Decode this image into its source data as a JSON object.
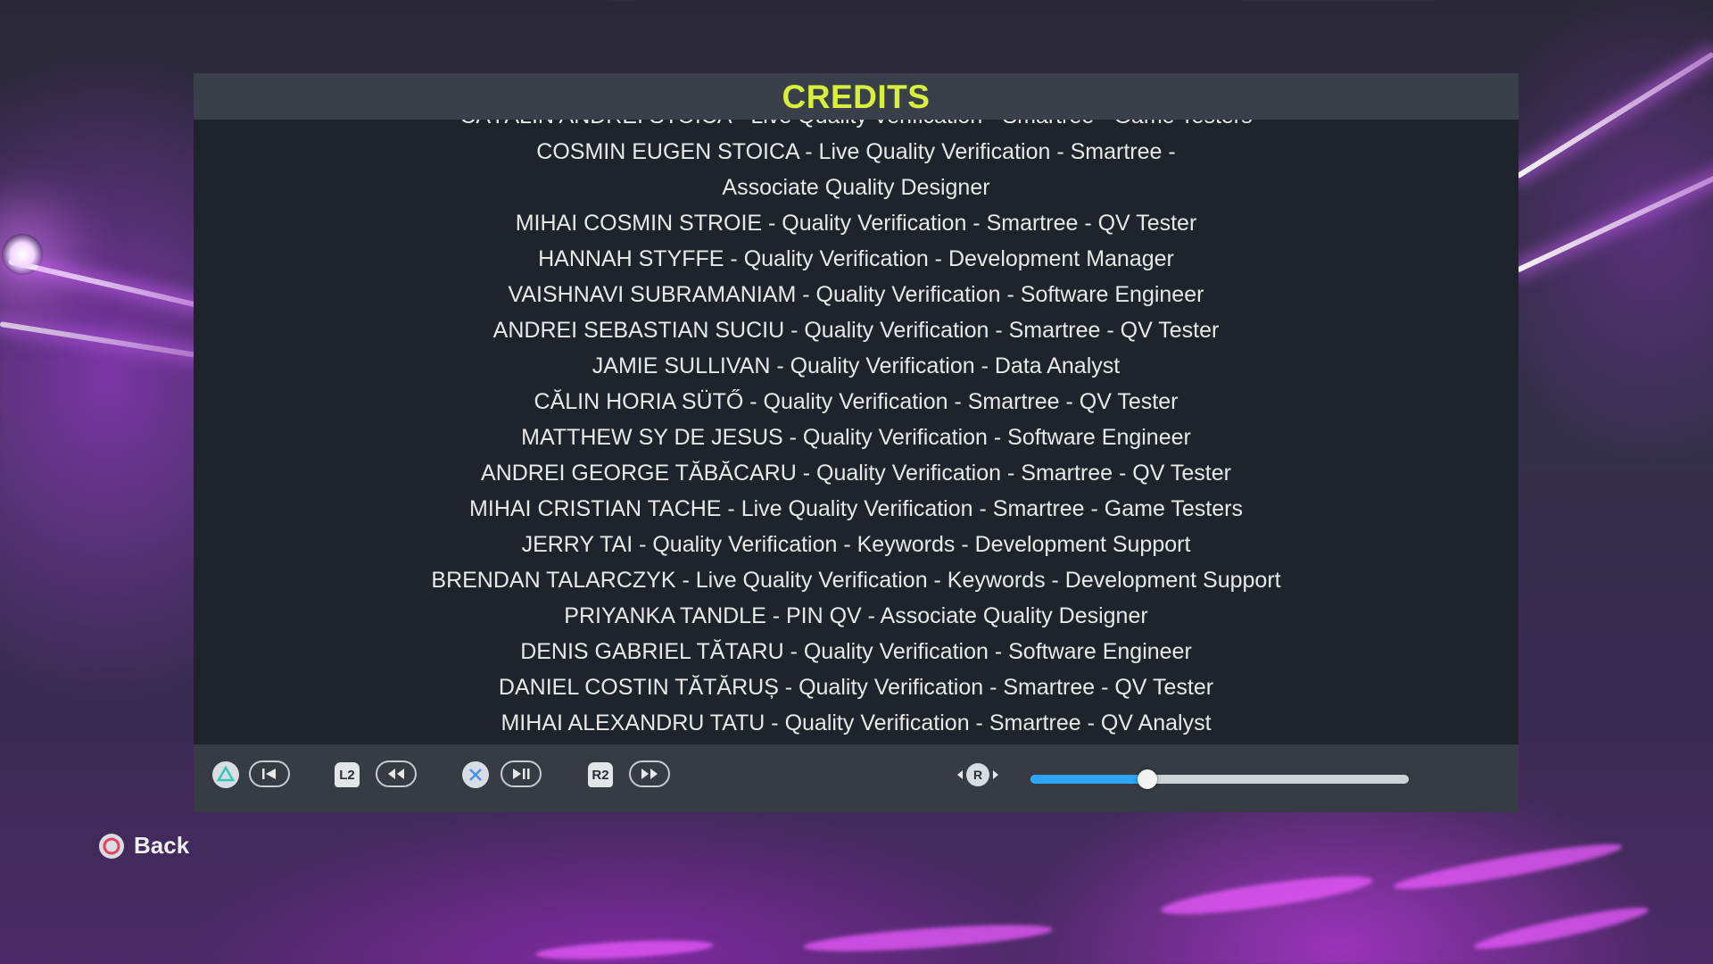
{
  "title": "CREDITS",
  "credits": [
    "CĂTĂLIN ANDREI STOICA - Live Quality Verification - Smartree - Game Testers",
    "COSMIN EUGEN STOICA - Live Quality Verification - Smartree - Associate Quality Designer",
    "MIHAI COSMIN STROIE - Quality Verification - Smartree - QV Tester",
    "HANNAH STYFFE - Quality Verification - Development Manager",
    "VAISHNAVI SUBRAMANIAM - Quality Verification - Software Engineer",
    "ANDREI SEBASTIAN SUCIU - Quality Verification - Smartree - QV Tester",
    "JAMIE SULLIVAN - Quality Verification - Data Analyst",
    "CĂLIN HORIA SÜTŐ - Quality Verification - Smartree - QV Tester",
    "MATTHEW SY DE JESUS - Quality Verification - Software Engineer",
    "ANDREI GEORGE TĂBĂCARU - Quality Verification - Smartree - QV Tester",
    "MIHAI CRISTIAN TACHE - Live Quality Verification - Smartree - Game Testers",
    "JERRY TAI - Quality Verification - Keywords - Development Support",
    "BRENDAN TALARCZYK - Live Quality Verification - Keywords - Development Support",
    "PRIYANKA TANDLE - PIN QV - Associate Quality Designer",
    "DENIS GABRIEL TĂTARU - Quality Verification - Software Engineer",
    "DANIEL COSTIN TĂTĂRUȘ - Quality Verification - Smartree - QV Tester",
    "MIHAI ALEXANDRU TATU - Quality Verification - Smartree - QV Analyst"
  ],
  "controls": {
    "l2_label": "L2",
    "r2_label": "R2",
    "r_stick_label": "R",
    "progress": 0.31
  },
  "back": {
    "label": "Back"
  },
  "colors": {
    "title": "#d8f03c",
    "progress_fill": "#2ea6ff",
    "triangle": "#33c8b4",
    "cross": "#4b8fe8",
    "circle": "#e8425a"
  },
  "icons": [
    "triangle-button-icon",
    "skip-to-start-icon",
    "rewind-icon",
    "cross-button-icon",
    "play-pause-icon",
    "fast-forward-icon",
    "right-stick-icon",
    "circle-button-icon"
  ]
}
